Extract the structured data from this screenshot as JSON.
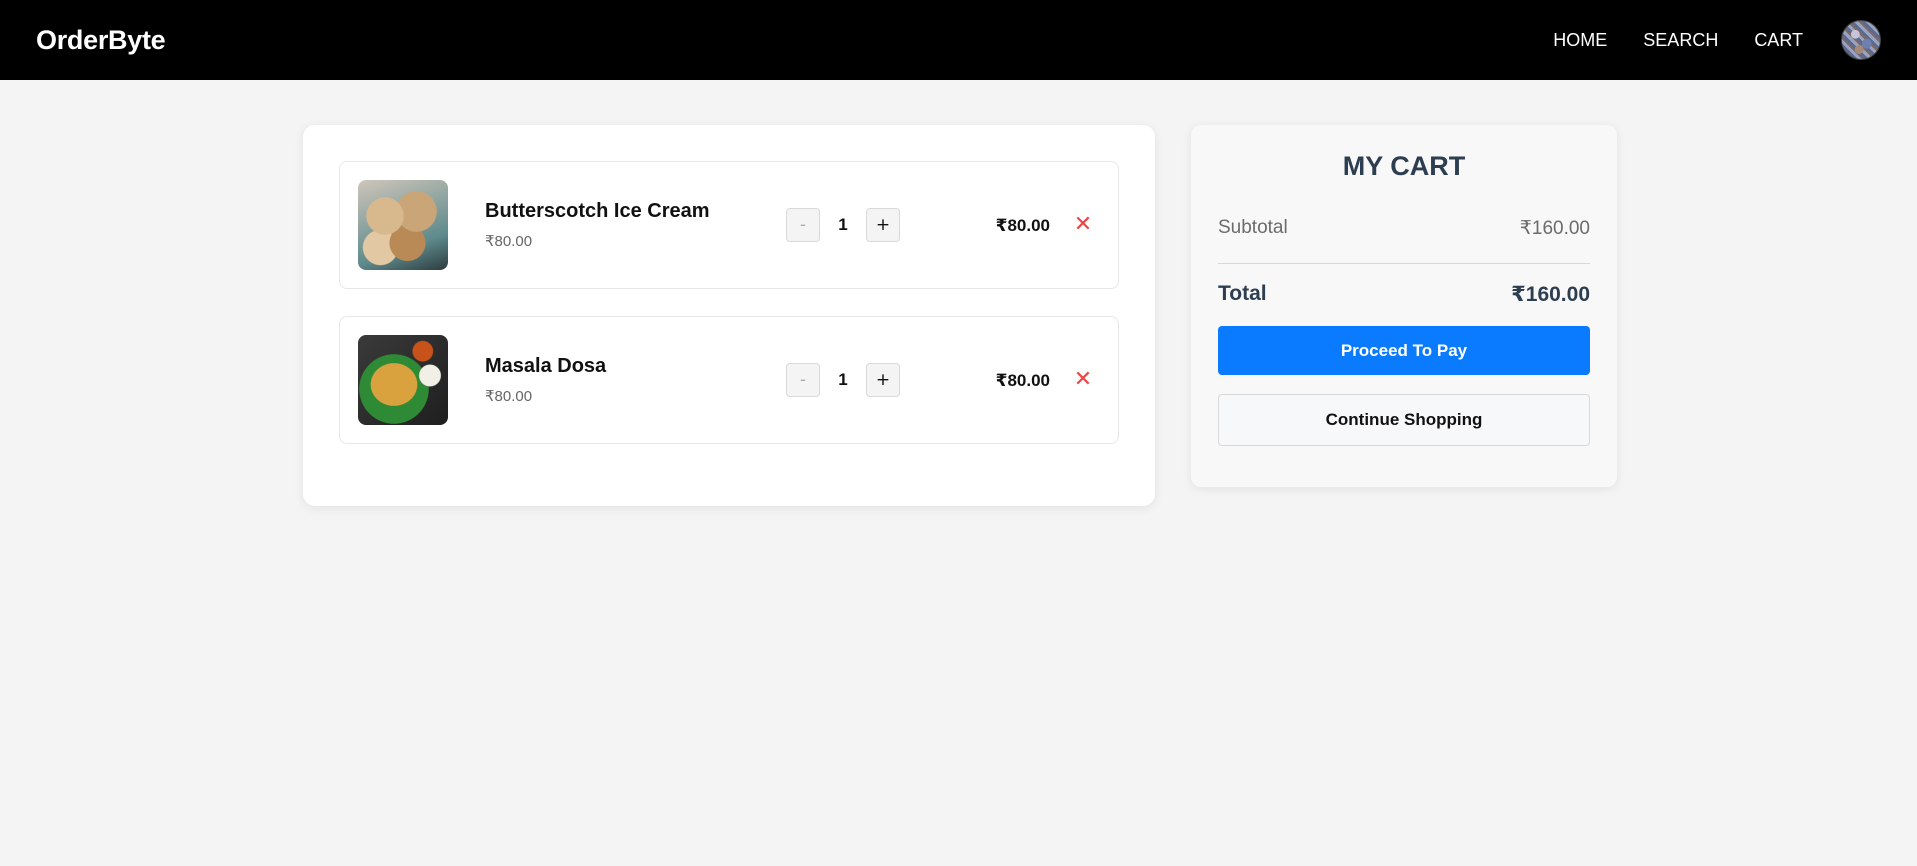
{
  "navbar": {
    "brand": "OrderByte",
    "links": [
      "HOME",
      "SEARCH",
      "CART"
    ],
    "avatar_icon": "user-avatar"
  },
  "cart": {
    "items": [
      {
        "name": "Butterscotch Ice Cream",
        "unit_price": "₹80.00",
        "quantity": "1",
        "line_total": "₹80.00",
        "image": "butterscotch-ice-cream-image"
      },
      {
        "name": "Masala Dosa",
        "unit_price": "₹80.00",
        "quantity": "1",
        "line_total": "₹80.00",
        "image": "masala-dosa-image"
      }
    ],
    "decrement_label": "-",
    "increment_label": "+",
    "remove_label": "✕"
  },
  "summary": {
    "title": "MY CART",
    "subtotal_label": "Subtotal",
    "subtotal_value": "₹160.00",
    "total_label": "Total",
    "total_value": "₹160.00",
    "pay_button": "Proceed To Pay",
    "continue_button": "Continue Shopping"
  },
  "colors": {
    "navbar": "#000000",
    "primary": "#0a7bff",
    "remove": "#ef4444",
    "heading": "#2d3e50"
  }
}
